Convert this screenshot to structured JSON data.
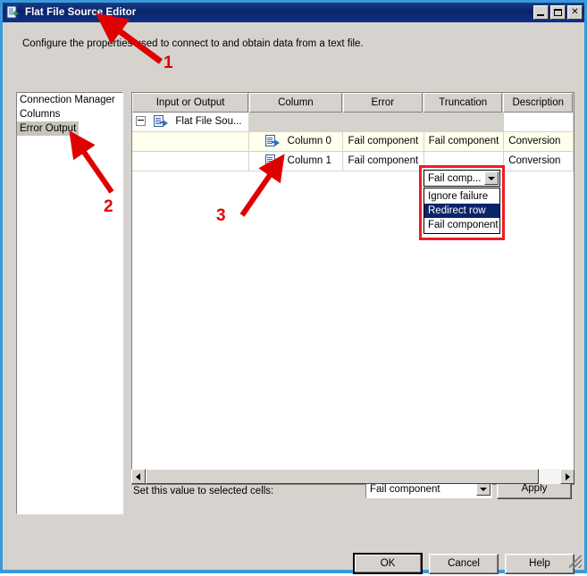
{
  "window": {
    "title": "Flat File Source Editor",
    "icon": "flat-file-icon",
    "minimize_label": "_",
    "maximize_label": "□",
    "close_label": "✕",
    "accent_border": "#3a9ad9",
    "titlebar_color": "#0a246a",
    "face_color": "#d6d3ce"
  },
  "description": "Configure the properties used to connect to and obtain data from a text file.",
  "pages": {
    "items": [
      {
        "label": "Connection Manager",
        "selected": false
      },
      {
        "label": "Columns",
        "selected": false
      },
      {
        "label": "Error Output",
        "selected": true
      }
    ]
  },
  "grid": {
    "columns": [
      "Input or Output",
      "Column",
      "Error",
      "Truncation",
      "Description"
    ],
    "rows": [
      {
        "type": "parent",
        "expander": "minus",
        "input_or_output": "Flat File Sou...",
        "column": "",
        "error": "",
        "truncation": "",
        "description": ""
      },
      {
        "type": "child",
        "highlight": "yellow",
        "input_or_output": "",
        "column": "Column 0",
        "error": "Fail component",
        "truncation": "Fail component",
        "description": "Conversion"
      },
      {
        "type": "child",
        "highlight": "none",
        "input_or_output": "",
        "column": "Column 1",
        "error": "Fail component",
        "truncation": "Fail component",
        "description": "Conversion"
      }
    ]
  },
  "cell_editor": {
    "value": "Fail comp...",
    "open": true,
    "options": [
      {
        "label": "Ignore failure",
        "selected": false
      },
      {
        "label": "Redirect row",
        "selected": true
      },
      {
        "label": "Fail component",
        "selected": false
      }
    ],
    "highlight_color": "#ee1c25"
  },
  "footer": {
    "set_value_label": "Set this value to selected cells:",
    "set_value_combo": "Fail component",
    "apply_label": "Apply"
  },
  "buttons": {
    "ok": "OK",
    "cancel": "Cancel",
    "help": "Help"
  },
  "scrollbar": {
    "left_arrow": "◄",
    "right_arrow": "►"
  },
  "annotations": [
    {
      "number": "1"
    },
    {
      "number": "2"
    },
    {
      "number": "3"
    }
  ]
}
